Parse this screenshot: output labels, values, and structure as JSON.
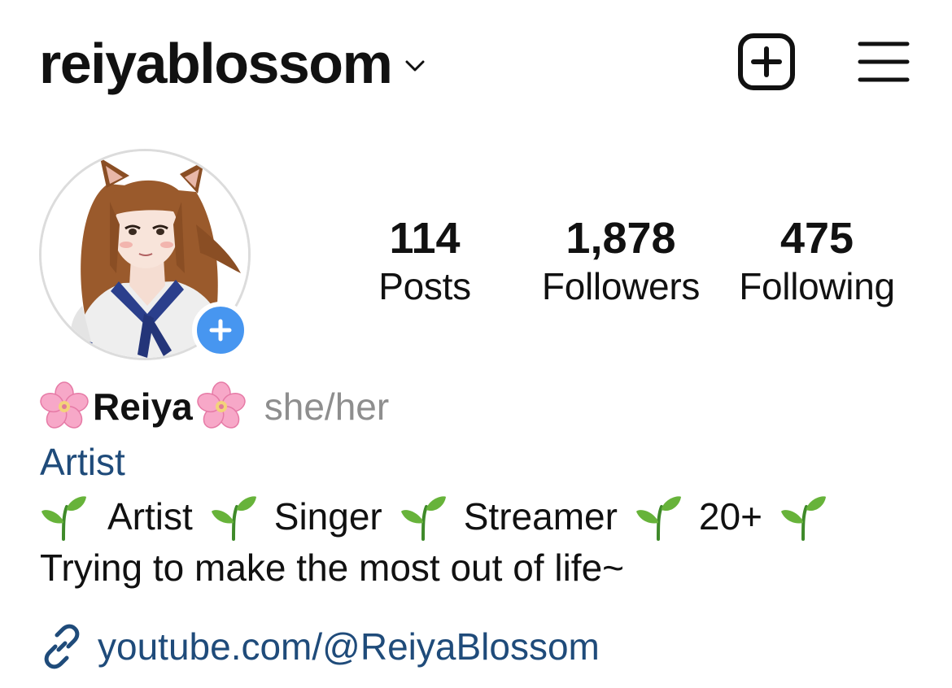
{
  "header": {
    "username": "reiyablossom",
    "icons": {
      "switch": "chevron-down-icon",
      "create": "new-post-icon",
      "menu": "hamburger-menu-icon"
    }
  },
  "avatar": {
    "icon": "avatar-illustration",
    "story_button": "plus-icon"
  },
  "stats": [
    {
      "value": "114",
      "label": "Posts"
    },
    {
      "value": "1,878",
      "label": "Followers"
    },
    {
      "value": "475",
      "label": "Following"
    }
  ],
  "profile": {
    "name": "Reiya",
    "name_decoration": "cherry-blossom-emoji",
    "pronouns": "she/her",
    "category": "Artist",
    "bio_tags": [
      "Artist",
      "Singer",
      "Streamer",
      "20+"
    ],
    "bio_tag_separator": "seedling-emoji",
    "bio_line2": "Trying to make the most out of life~",
    "link": "youtube.com/@ReiyaBlossom",
    "link_icon": "link-icon"
  },
  "colors": {
    "text": "#111111",
    "secondary": "#8e8e8e",
    "link": "#1f4b7a",
    "story_button": "#4796f0"
  }
}
